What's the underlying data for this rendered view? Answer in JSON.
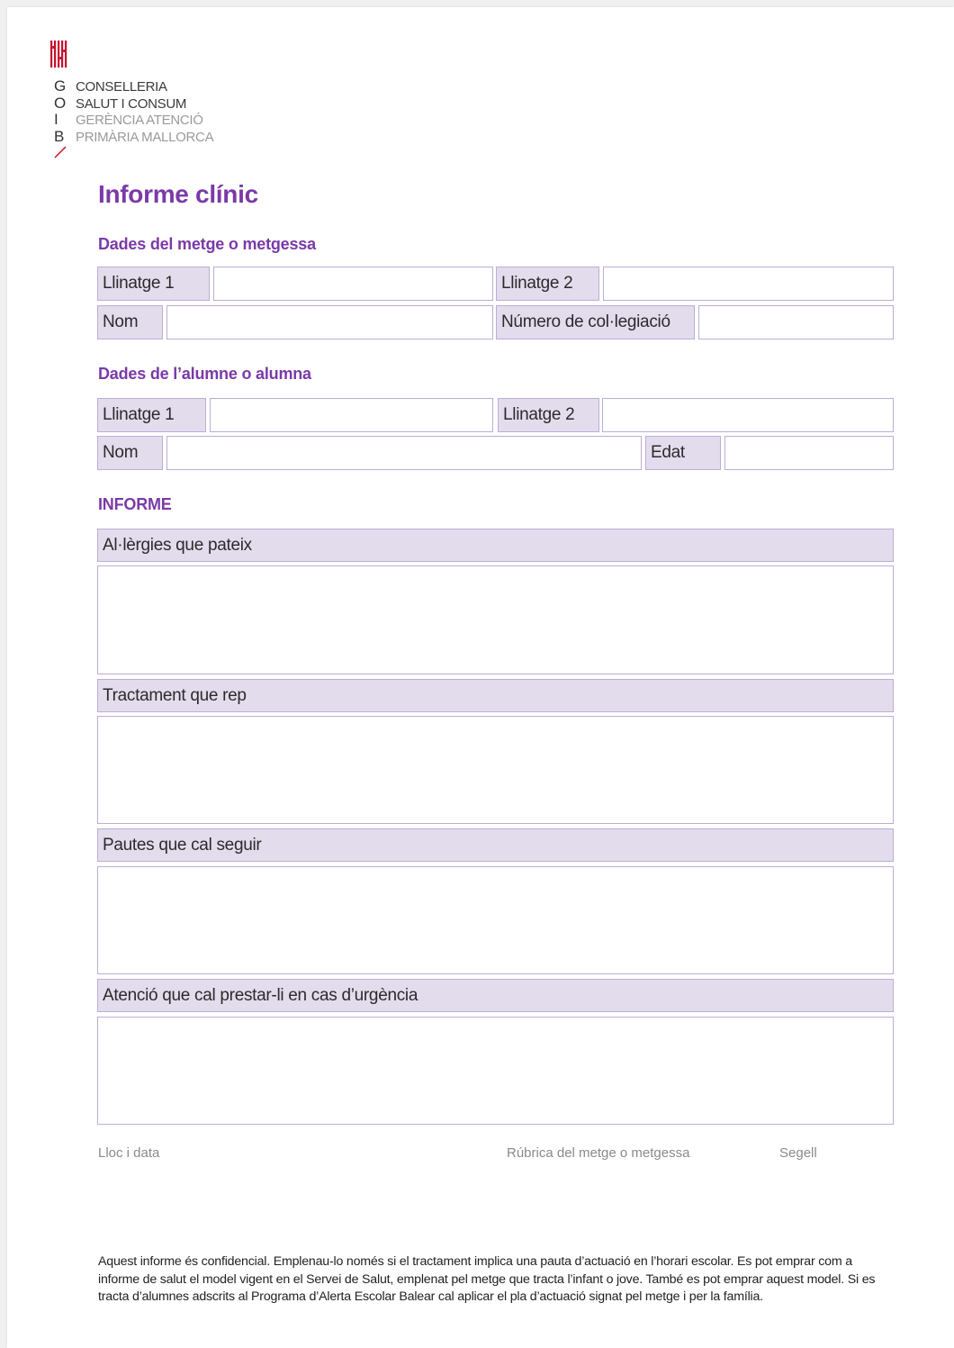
{
  "logo": {
    "letters": [
      "G",
      "O",
      "I",
      "B"
    ],
    "lines": [
      "CONSELLERIA",
      "SALUT I CONSUM",
      "GERÈNCIA ATENCIÓ",
      "PRIMÀRIA MALLORCA"
    ],
    "brand_color": "#c8102e"
  },
  "title": "Informe clínic",
  "doctor_section": {
    "heading": "Dades del metge o metgessa",
    "surname1_label": "Llinatge 1",
    "surname2_label": "Llinatge 2",
    "name_label": "Nom",
    "college_number_label": "Número de col·legiació"
  },
  "student_section": {
    "heading": "Dades de l’alumne o alumna",
    "surname1_label": "Llinatge 1",
    "surname2_label": "Llinatge 2",
    "name_label": "Nom",
    "age_label": "Edat"
  },
  "report_section": {
    "heading": "INFORME",
    "allergies_label": "Al·lèrgies que pateix",
    "treatment_label": "Tractament que rep",
    "guidelines_label": "Pautes que cal seguir",
    "emergency_label": "Atenció que cal prestar-li en cas d’urgència"
  },
  "signature": {
    "place_date": "Lloc i data",
    "doctor_signature": "Rúbrica del metge o metgessa",
    "stamp": "Segell"
  },
  "footnote": "Aquest informe és confidencial. Emplenau-lo només si el tractament implica una pauta d’actuació en l’horari escolar. Es pot emprar com a informe de salut el model vigent en el Servei de Salut, emplenat pel metge que tracta l’infant o jove. També es pot emprar aquest model. Si es tracta d’alumnes adscrits al Programa d’Alerta Escolar Balear cal aplicar el pla d’actuació signat pel metge i per la família.",
  "colors": {
    "accent": "#7a3aa8",
    "label_bg": "#e3dced",
    "border": "#bcaed6"
  }
}
